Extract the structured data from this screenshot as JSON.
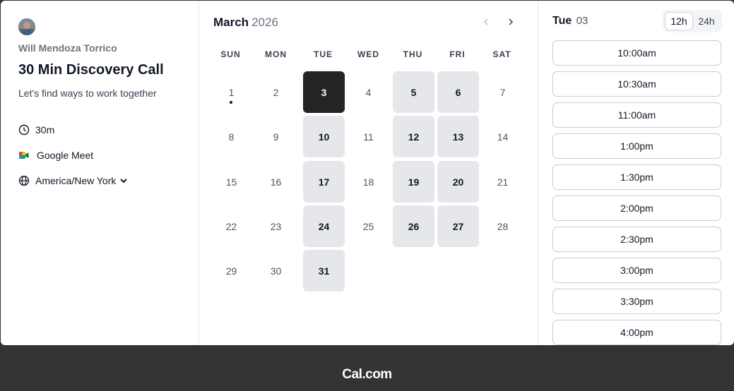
{
  "profile": {
    "owner_name": "Will Mendoza Torrico",
    "event_title": "30 Min Discovery Call",
    "event_description": "Let's find ways to work together",
    "duration": "30m",
    "location": "Google Meet",
    "timezone": "America/New York"
  },
  "calendar": {
    "month": "March",
    "year": "2026",
    "weekdays": [
      "SUN",
      "MON",
      "TUE",
      "WED",
      "THU",
      "FRI",
      "SAT"
    ],
    "days": [
      {
        "n": "1",
        "state": "plain",
        "today": true
      },
      {
        "n": "2",
        "state": "plain"
      },
      {
        "n": "3",
        "state": "selected"
      },
      {
        "n": "4",
        "state": "plain"
      },
      {
        "n": "5",
        "state": "available"
      },
      {
        "n": "6",
        "state": "available"
      },
      {
        "n": "7",
        "state": "plain"
      },
      {
        "n": "8",
        "state": "plain"
      },
      {
        "n": "9",
        "state": "plain"
      },
      {
        "n": "10",
        "state": "available"
      },
      {
        "n": "11",
        "state": "plain"
      },
      {
        "n": "12",
        "state": "available"
      },
      {
        "n": "13",
        "state": "available"
      },
      {
        "n": "14",
        "state": "plain"
      },
      {
        "n": "15",
        "state": "plain"
      },
      {
        "n": "16",
        "state": "plain"
      },
      {
        "n": "17",
        "state": "available"
      },
      {
        "n": "18",
        "state": "plain"
      },
      {
        "n": "19",
        "state": "available"
      },
      {
        "n": "20",
        "state": "available"
      },
      {
        "n": "21",
        "state": "plain"
      },
      {
        "n": "22",
        "state": "plain"
      },
      {
        "n": "23",
        "state": "plain"
      },
      {
        "n": "24",
        "state": "available"
      },
      {
        "n": "25",
        "state": "plain"
      },
      {
        "n": "26",
        "state": "available"
      },
      {
        "n": "27",
        "state": "available"
      },
      {
        "n": "28",
        "state": "plain"
      },
      {
        "n": "29",
        "state": "plain"
      },
      {
        "n": "30",
        "state": "plain"
      },
      {
        "n": "31",
        "state": "available"
      }
    ]
  },
  "slots_panel": {
    "weekday": "Tue",
    "day": "03",
    "format_12h": "12h",
    "format_24h": "24h",
    "active_format": "12h",
    "slots": [
      "10:00am",
      "10:30am",
      "11:00am",
      "1:00pm",
      "1:30pm",
      "2:00pm",
      "2:30pm",
      "3:00pm",
      "3:30pm",
      "4:00pm"
    ]
  },
  "footer": {
    "brand": "Cal.com"
  },
  "icons": {
    "duration": "clock-icon",
    "location": "google-meet-icon",
    "timezone": "globe-icon",
    "prev": "chevron-left-icon",
    "next": "chevron-right-icon"
  },
  "colors": {
    "selected_day": "#242424",
    "available_day": "#e5e7eb",
    "footer_bg": "#333333"
  }
}
